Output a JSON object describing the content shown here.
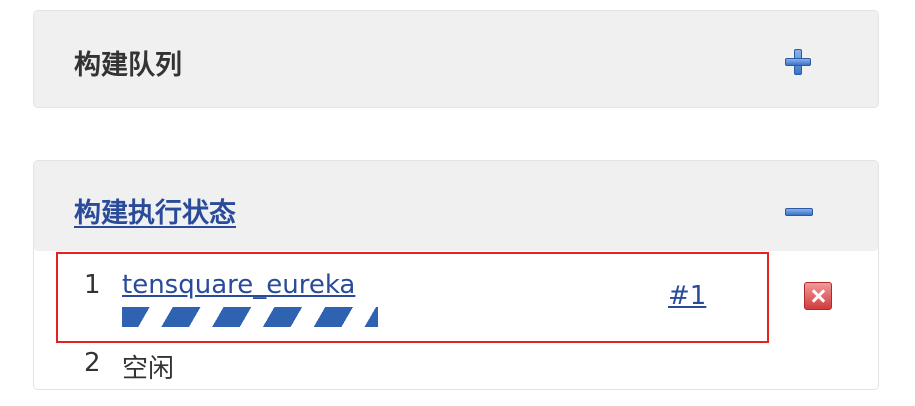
{
  "build_queue": {
    "title": "构建队列",
    "toggle_icon": "plus-icon"
  },
  "executor_status": {
    "title": "构建执行状态",
    "toggle_icon": "minus-icon",
    "executors": [
      {
        "number": "1",
        "job_name": "tensquare_eureka",
        "build_number": "#1",
        "progress": "indeterminate",
        "stop_icon": "stop-icon"
      },
      {
        "number": "2",
        "status": "空闲"
      }
    ]
  },
  "colors": {
    "link": "#2a4b9a",
    "progress": "#2f63b1",
    "highlight": "#e32222",
    "stop": "#d23b3b"
  }
}
